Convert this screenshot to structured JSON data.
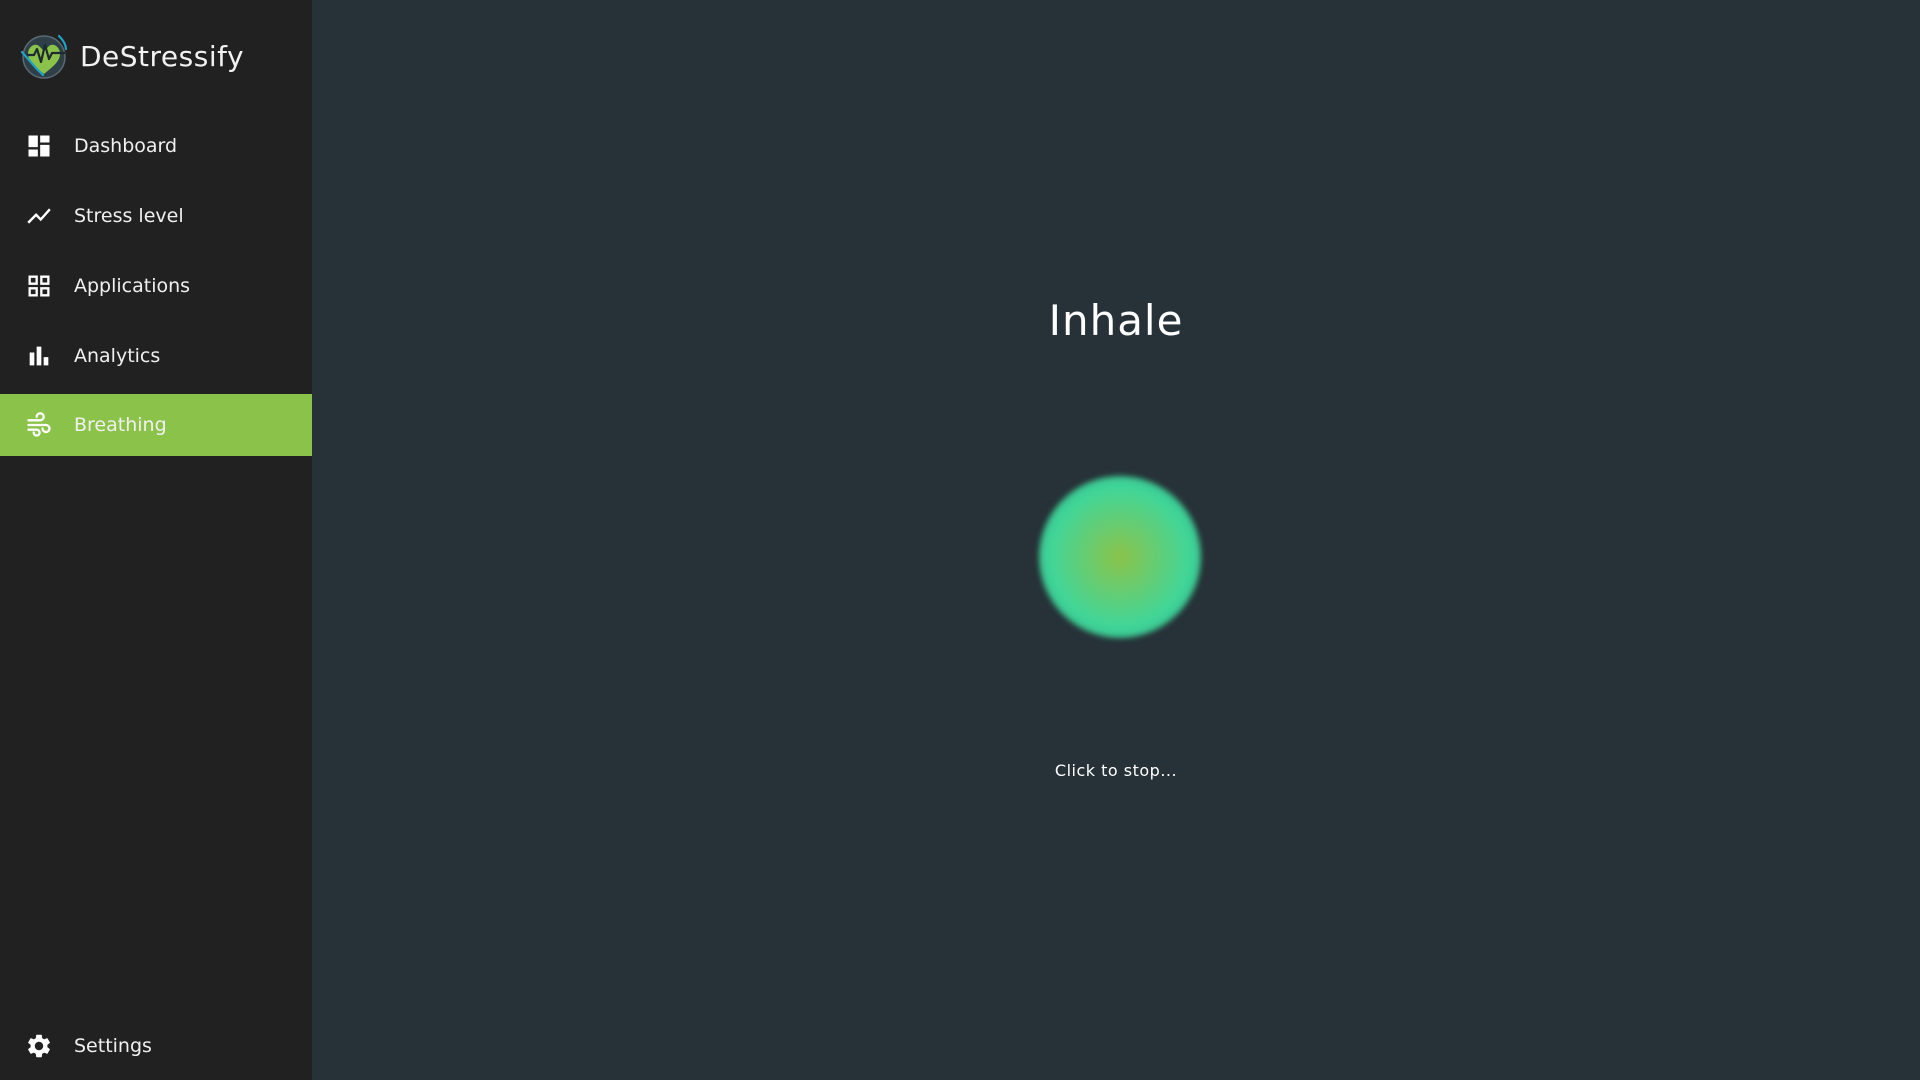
{
  "app": {
    "name": "DeStressify",
    "logo_icon": "heart-pulse-globe-icon"
  },
  "sidebar": {
    "items": [
      {
        "label": "Dashboard",
        "icon": "dashboard-icon",
        "active": false
      },
      {
        "label": "Stress level",
        "icon": "trend-line-icon",
        "active": false
      },
      {
        "label": "Applications",
        "icon": "apps-grid-icon",
        "active": false
      },
      {
        "label": "Analytics",
        "icon": "bar-chart-icon",
        "active": false
      },
      {
        "label": "Breathing",
        "icon": "wind-icon",
        "active": true
      }
    ],
    "settings": {
      "label": "Settings",
      "icon": "gear-icon"
    }
  },
  "breathing": {
    "phase": "Inhale",
    "hint": "Click to stop..."
  },
  "colors": {
    "sidebar_bg": "#212121",
    "main_bg": "#263238",
    "accent": "#8bc34a",
    "orb_outer": "#3fd69a",
    "orb_inner": "#8bc34a",
    "text": "#ffffff"
  }
}
